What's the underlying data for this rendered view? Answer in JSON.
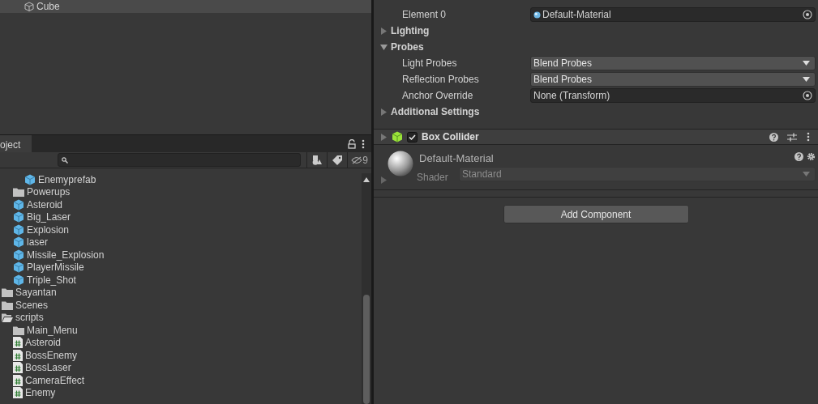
{
  "hierarchy": {
    "items": [
      {
        "name": "Cube",
        "selected": true
      }
    ]
  },
  "project": {
    "tab": "oject",
    "hidden_count": "9",
    "tree": [
      {
        "children": [
          {
            "children": [
              {
                "name": "Enemyprefab",
                "kind": "prefab"
              }
            ]
          },
          {
            "name": "Powerups",
            "kind": "folder"
          },
          {
            "name": "Asteroid",
            "kind": "prefab"
          },
          {
            "name": "Big_Laser",
            "kind": "prefab"
          },
          {
            "name": "Explosion",
            "kind": "prefab"
          },
          {
            "name": "laser",
            "kind": "prefab"
          },
          {
            "name": "Missile_Explosion",
            "kind": "prefab"
          },
          {
            "name": "PlayerMissile",
            "kind": "prefab"
          },
          {
            "name": "Triple_Shot",
            "kind": "prefab"
          }
        ]
      },
      {
        "name": "Sayantan",
        "kind": "folder"
      },
      {
        "name": "Scenes",
        "kind": "folder"
      },
      {
        "name": "scripts",
        "kind": "folder",
        "expanded": true,
        "children": [
          {
            "name": "Main_Menu",
            "kind": "folder"
          },
          {
            "name": "Asteroid",
            "kind": "script"
          },
          {
            "name": "BossEnemy",
            "kind": "script"
          },
          {
            "name": "BossLaser",
            "kind": "script"
          },
          {
            "name": "CameraEffect",
            "kind": "script"
          },
          {
            "name": "Enemy",
            "kind": "script"
          }
        ]
      }
    ]
  },
  "inspector": {
    "rows": [
      {
        "kind": "object",
        "label": "Element 0",
        "value": "Default-Material"
      },
      {
        "kind": "foldout",
        "label": "Lighting",
        "expanded": false
      },
      {
        "kind": "foldout",
        "label": "Probes",
        "expanded": true
      },
      {
        "kind": "dropdown",
        "label": "Light Probes",
        "value": "Blend Probes"
      },
      {
        "kind": "dropdown",
        "label": "Reflection Probes",
        "value": "Blend Probes"
      },
      {
        "kind": "object",
        "label": "Anchor Override",
        "value": "None (Transform)"
      },
      {
        "kind": "foldout",
        "label": "Additional Settings",
        "expanded": false
      }
    ],
    "component": {
      "title": "Box Collider",
      "enabled": true
    },
    "material": {
      "name": "Default-Material",
      "shader_label": "Shader",
      "shader": "Standard"
    },
    "add_button": "Add Component"
  }
}
